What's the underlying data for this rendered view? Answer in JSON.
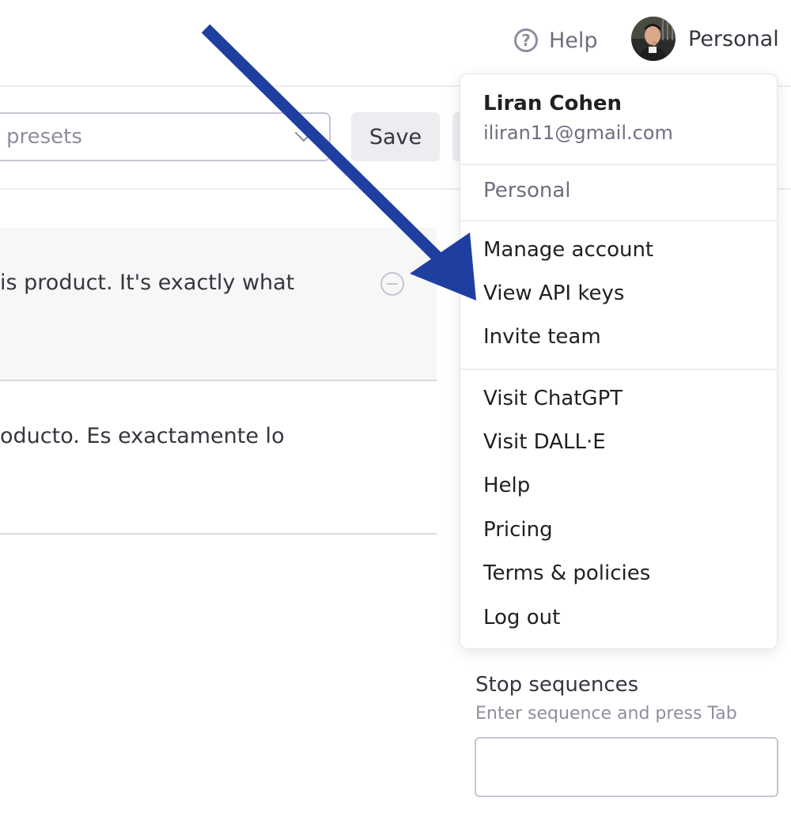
{
  "header": {
    "help_label": "Help",
    "help_icon": "question-circle-icon",
    "account_label": "Personal"
  },
  "toolbar": {
    "preset_placeholder": "presets",
    "save_label": "Save"
  },
  "messages": [
    {
      "role": "user",
      "text": "is product. It's exactly what"
    },
    {
      "role": "assistant",
      "text": "oducto. Es exactamente lo"
    }
  ],
  "account_menu": {
    "name": "Liran Cohen",
    "email": "iliran11@gmail.com",
    "org": "Personal",
    "account_items": [
      "Manage account",
      "View API keys",
      "Invite team"
    ],
    "link_items": [
      "Visit ChatGPT",
      "Visit DALL·E",
      "Help",
      "Pricing",
      "Terms & policies",
      "Log out"
    ]
  },
  "stop_sequences": {
    "title": "Stop sequences",
    "hint": "Enter sequence and press Tab",
    "value": ""
  },
  "colors": {
    "arrow": "#1f3fa0",
    "border": "#c5c5d2",
    "muted_text": "#8e8ea0"
  }
}
